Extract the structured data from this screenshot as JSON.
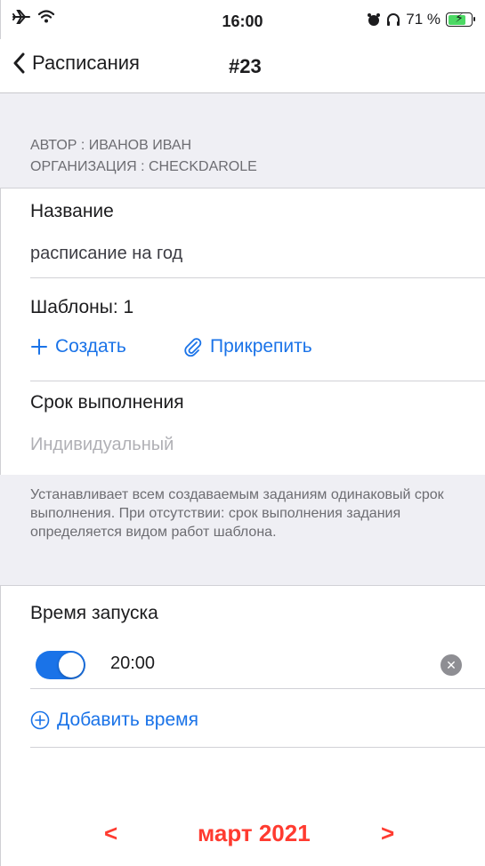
{
  "status_bar": {
    "time": "16:00",
    "battery_text": "71 %",
    "icons": [
      "airplane-icon",
      "wifi-icon",
      "alarm-icon",
      "headphones-icon",
      "battery-charging-icon"
    ]
  },
  "nav": {
    "back_label": "Расписания",
    "title": "#23"
  },
  "meta": {
    "author": "АВТОР : ИВАНОВ ИВАН",
    "organization": "ОРГАНИЗАЦИЯ : CHECKDAROLE"
  },
  "name_section": {
    "label": "Название",
    "value": "расписание на год"
  },
  "templates_section": {
    "label": "Шаблоны: 1",
    "create_label": "Создать",
    "attach_label": "Прикрепить"
  },
  "deadline_section": {
    "label": "Срок выполнения",
    "placeholder": "Индивидуальный",
    "note": "Устанавливает всем создаваемым заданиям одинаковый срок выполнения. При отсутствии: срок выполнения задания определяется видом работ шаблона."
  },
  "launch_section": {
    "label": "Время запуска",
    "times": [
      {
        "time": "20:00",
        "enabled": true
      }
    ],
    "add_time_label": "Добавить время"
  },
  "calendar_nav": {
    "prev": "<",
    "month": "март 2021",
    "next": ">"
  },
  "colors": {
    "accent": "#1a73e8",
    "calendar_red": "#ff3b30",
    "section_bg": "#efeff4"
  }
}
